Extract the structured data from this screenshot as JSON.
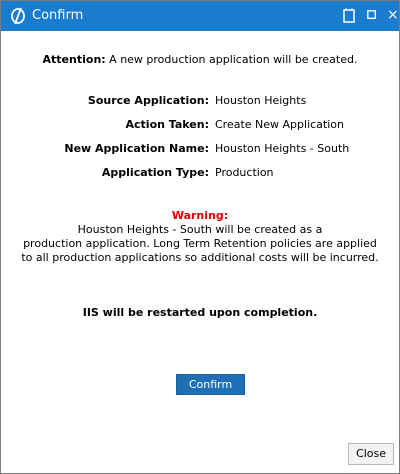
{
  "window": {
    "title": "Confirm",
    "logo_icon": "app-logo-icon",
    "controls": {
      "document_icon": "document-icon",
      "maximize_icon": "maximize-icon",
      "close_glyph": "×"
    },
    "title_color": "#1a7ccf"
  },
  "attention": {
    "label": "Attention:",
    "text": " A new production application will be created."
  },
  "details": [
    {
      "label": "Source Application:",
      "value": "Houston Heights"
    },
    {
      "label": "Action Taken:",
      "value": "Create New Application"
    },
    {
      "label": "New Application Name:",
      "value": "Houston Heights - South"
    },
    {
      "label": "Application Type:",
      "value": "Production"
    }
  ],
  "warning": {
    "title": "Warning:",
    "lines": [
      "Houston Heights - South will be created as a",
      "production application. Long Term Retention policies are applied",
      "to all production applications so additional costs will be incurred."
    ],
    "title_color": "#e00000"
  },
  "restart_notice": "IIS will be restarted upon completion.",
  "buttons": {
    "confirm": "Confirm",
    "close": "Close",
    "confirm_color": "#1f6fb6"
  }
}
